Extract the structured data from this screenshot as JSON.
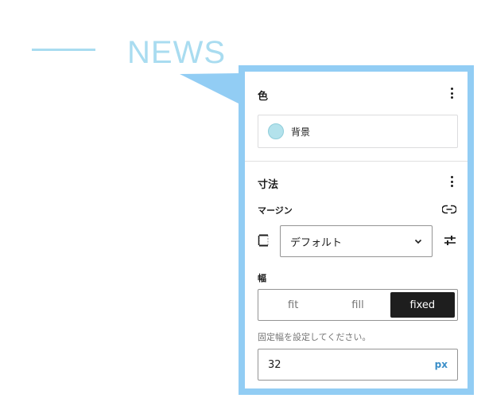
{
  "hero": {
    "title": "NEWS"
  },
  "colors": {
    "accent": "#92cdf4",
    "swatch": "#b3e2ec",
    "hero": "#a9dcf0"
  },
  "color_panel": {
    "heading": "色",
    "options_icon": "more-vertical-icon",
    "items": [
      {
        "label": "背景"
      }
    ]
  },
  "dimensions_panel": {
    "heading": "寸法",
    "options_icon": "more-vertical-icon",
    "margin": {
      "label": "マージン",
      "value": "デフォルト",
      "link_icon": "link-icon",
      "tune_icon": "settings-sliders-icon"
    },
    "width": {
      "label": "幅",
      "options": [
        {
          "label": "fit"
        },
        {
          "label": "fill"
        },
        {
          "label": "fixed"
        }
      ],
      "selected": "fixed",
      "help": "固定幅を設定してください。",
      "value": "32",
      "unit": "px"
    }
  }
}
